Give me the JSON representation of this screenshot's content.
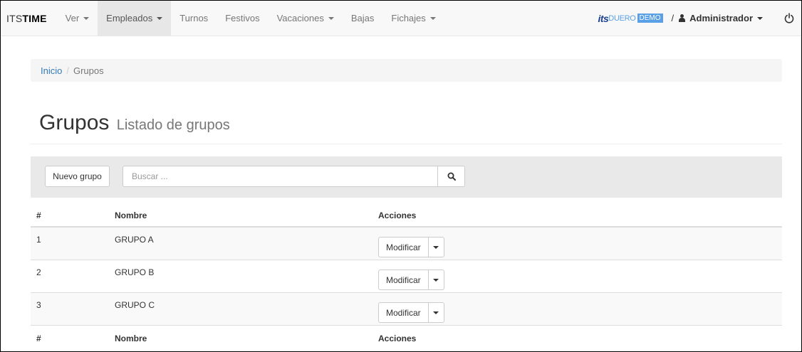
{
  "navbar": {
    "brand_its": "ITS",
    "brand_time": "TIME",
    "items": [
      {
        "label": "Ver",
        "dropdown": true,
        "active": false
      },
      {
        "label": "Empleados",
        "dropdown": true,
        "active": true
      },
      {
        "label": "Turnos",
        "dropdown": false,
        "active": false
      },
      {
        "label": "Festivos",
        "dropdown": false,
        "active": false
      },
      {
        "label": "Vacaciones",
        "dropdown": true,
        "active": false
      },
      {
        "label": "Bajas",
        "dropdown": false,
        "active": false
      },
      {
        "label": "Fichajes",
        "dropdown": true,
        "active": false
      }
    ],
    "logo_its": "its",
    "logo_duero": "DUERO",
    "logo_demo": "DEMO",
    "separator": "/",
    "user_label": "Administrador",
    "icons": {
      "user": "user-icon",
      "power": "power-icon"
    }
  },
  "breadcrumb": {
    "home": "Inicio",
    "divider": "/",
    "current": "Grupos"
  },
  "header": {
    "title": "Grupos",
    "subtitle": "Listado de grupos"
  },
  "toolbar": {
    "new_button": "Nuevo grupo",
    "search_placeholder": "Buscar ...",
    "search_value": "",
    "search_icon": "search-icon"
  },
  "table": {
    "columns": [
      "#",
      "Nombre",
      "Acciones"
    ],
    "rows": [
      {
        "num": "1",
        "name": "GRUPO A",
        "action": "Modificar"
      },
      {
        "num": "2",
        "name": "GRUPO B",
        "action": "Modificar"
      },
      {
        "num": "3",
        "name": "GRUPO C",
        "action": "Modificar"
      }
    ]
  },
  "colors": {
    "link": "#337ab7",
    "navbar_bg": "#f8f8f8",
    "well_bg": "#e9e9e9",
    "logo_dark": "#1b3f8b",
    "logo_light": "#5aa0e6"
  }
}
